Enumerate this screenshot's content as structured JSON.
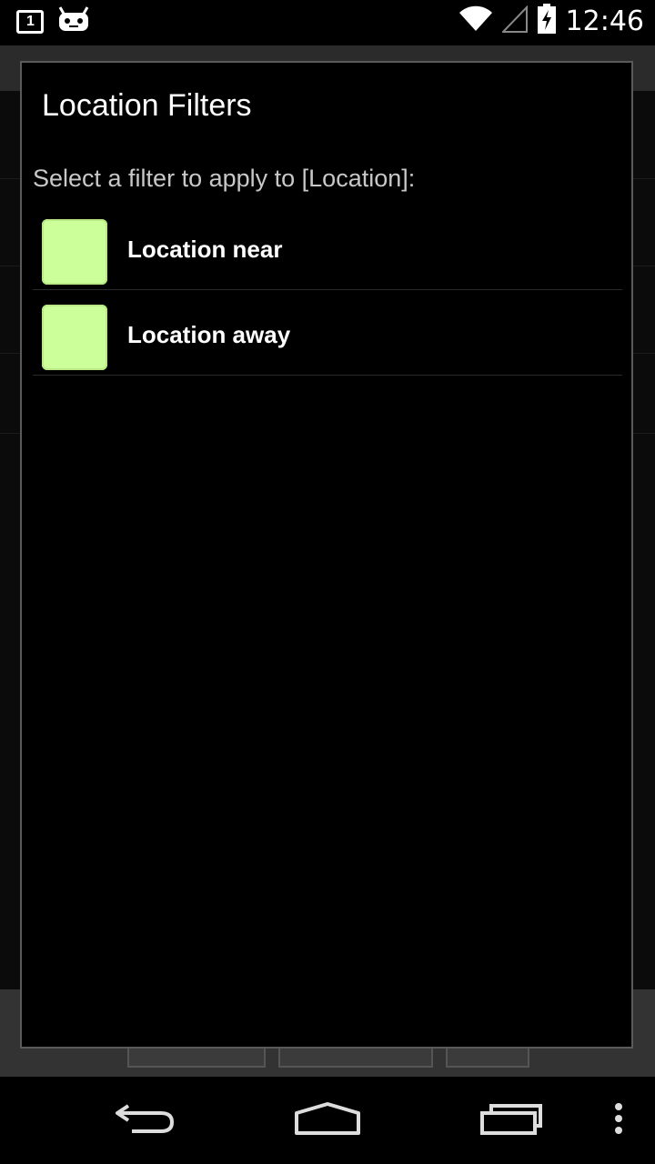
{
  "status_bar": {
    "time": "12:46",
    "notification_badge": "1",
    "icons": [
      "notification-count-icon",
      "cyanogenmod-android-icon",
      "wifi-icon",
      "cell-signal-icon",
      "battery-charging-icon"
    ]
  },
  "dialog": {
    "title": "Location Filters",
    "message": "Select a filter to apply to [Location]:",
    "items": [
      {
        "label": "Location near",
        "color": "#ccff99"
      },
      {
        "label": "Location away",
        "color": "#ccff99"
      }
    ]
  },
  "navigation": {
    "buttons": [
      "back-icon",
      "home-icon",
      "recent-apps-icon",
      "overflow-menu-icon"
    ]
  }
}
